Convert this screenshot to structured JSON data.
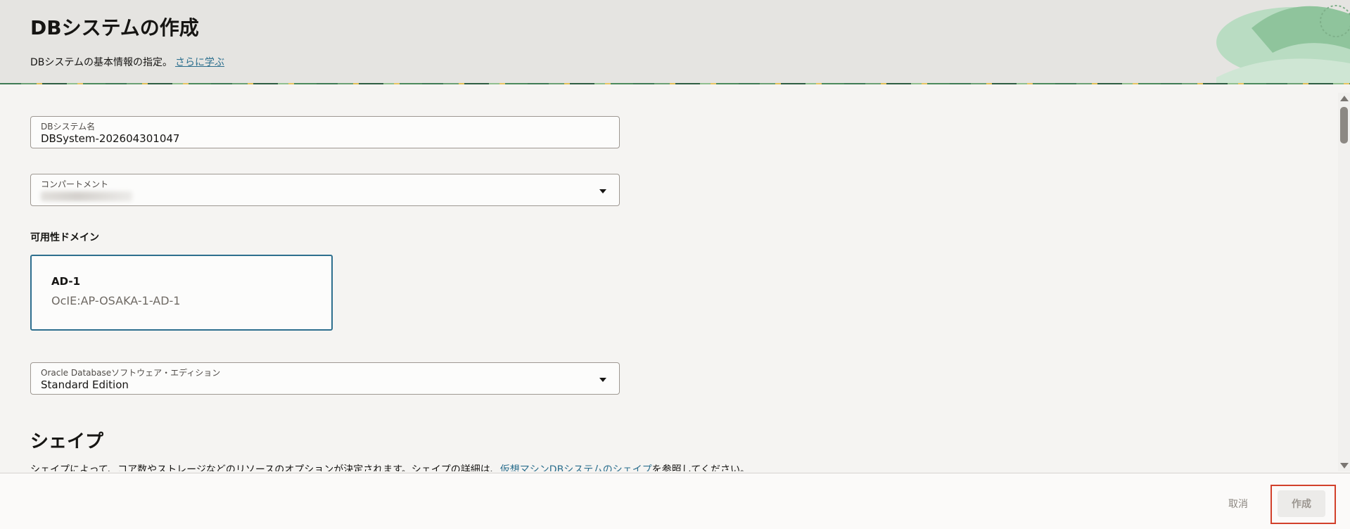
{
  "header": {
    "title": "DBシステムの作成",
    "description": "DBシステムの基本情報の指定。",
    "learn_more_link": "さらに学ぶ"
  },
  "form": {
    "db_system_name": {
      "label": "DBシステム名",
      "value": "DBSystem-202604301047"
    },
    "compartment": {
      "label": "コンパートメント"
    },
    "availability_domain": {
      "label": "可用性ドメイン",
      "selected": {
        "name": "AD-1",
        "id": "OcIE:AP-OSAKA-1-AD-1"
      }
    },
    "software_edition": {
      "label": "Oracle Databaseソフトウェア・エディション",
      "value": "Standard Edition"
    }
  },
  "shape_section": {
    "title": "シェイプ",
    "desc_prefix": "シェイプによって、コア数やストレージなどのリソースのオプションが決定されます。シェイプの詳細は、",
    "desc_link": "仮想マシンDBシステムのシェイプ",
    "desc_suffix": "を参照してください。"
  },
  "footer": {
    "cancel_label": "取消",
    "create_label": "作成"
  },
  "colors": {
    "accent": "#2e6f8e",
    "highlight": "#d2402b",
    "header_bg": "#e5e4e1"
  }
}
